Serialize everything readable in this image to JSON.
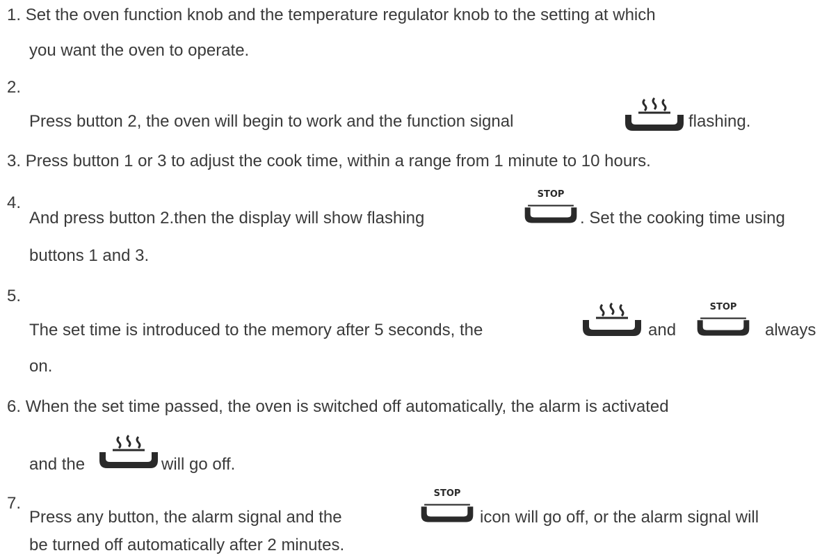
{
  "steps": [
    {
      "number": "1.",
      "line1": "Set the oven function knob and the temperature regulator knob to the setting at which",
      "line2": "you want the oven to operate."
    },
    {
      "number": "2.",
      "before": "Press button 2, the oven will begin to work and the function signal",
      "after": "flashing.",
      "icon": "cook-pot-steam-icon"
    },
    {
      "number": "3.",
      "line1": "Press button 1 or 3 to adjust the cook time, within a range from 1 minute to 10 hours."
    },
    {
      "number": "4.",
      "before": "And press button 2.then the display will show flashing",
      "after": ". Set the cooking time using",
      "line2": "buttons 1 and 3.",
      "icon": "cook-pot-stop-icon"
    },
    {
      "number": "5.",
      "before": "The set time is introduced to the memory after 5 seconds, the",
      "middle": "and",
      "after": "always",
      "line2": "on.",
      "icons": [
        "cook-pot-steam-icon",
        "cook-pot-stop-icon"
      ]
    },
    {
      "number": "6.",
      "line1": "When the set time passed, the oven is switched off automatically, the alarm is activated",
      "before2": "and the",
      "after2": "will go off.",
      "icon": "cook-pot-steam-icon"
    },
    {
      "number": "7.",
      "before": "Press any button, the alarm signal and the",
      "after": "icon will go off, or the alarm signal will",
      "line2": "be turned off automatically after 2 minutes.",
      "icon": "cook-pot-stop-icon"
    }
  ],
  "icon_labels": {
    "stop": "STOP"
  }
}
